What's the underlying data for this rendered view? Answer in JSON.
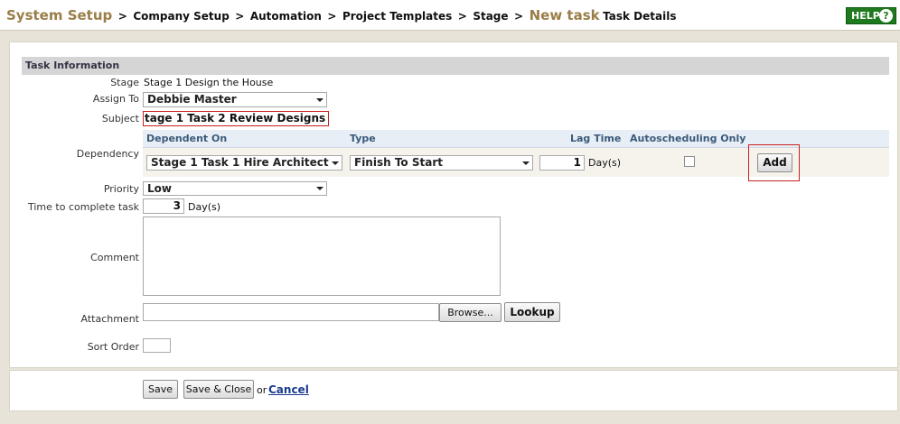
{
  "breadcrumb": {
    "root": "System Setup",
    "sep": ">",
    "items": [
      "Company Setup",
      "Automation",
      "Project Templates",
      "Stage"
    ],
    "current": "New task",
    "suffix": "Task Details"
  },
  "help": {
    "label": "HELP",
    "icon": "?"
  },
  "section": {
    "title": "Task Information"
  },
  "form": {
    "stage": {
      "label": "Stage",
      "value": "Stage 1 Design the House"
    },
    "assign_to": {
      "label": "Assign To",
      "value": "Debbie Master"
    },
    "subject": {
      "label": "Subject",
      "value": "tage 1 Task 2 Review Designs"
    },
    "dependency": {
      "label": "Dependency",
      "headers": {
        "dependent_on": "Dependent On",
        "type": "Type",
        "lag_time": "Lag Time",
        "autoscheduling": "Autoscheduling Only"
      },
      "row": {
        "dependent_on": "Stage 1 Task 1 Hire Architect",
        "type": "Finish To Start",
        "lag_value": "1",
        "lag_unit": "Day(s)",
        "autoscheduling_checked": false
      },
      "add_label": "Add"
    },
    "priority": {
      "label": "Priority",
      "value": "Low"
    },
    "time_to_complete": {
      "label": "Time to complete task",
      "value": "3",
      "unit": "Day(s)"
    },
    "comment": {
      "label": "Comment",
      "value": ""
    },
    "attachment": {
      "label": "Attachment",
      "value": "",
      "browse_label": "Browse...",
      "lookup_label": "Lookup"
    },
    "sort_order": {
      "label": "Sort Order",
      "value": ""
    }
  },
  "footer": {
    "save_label": "Save",
    "save_close_label": "Save & Close",
    "or_text": "or",
    "cancel_label": "Cancel"
  },
  "colors": {
    "accent_brown": "#9a7e48",
    "help_green": "#1f7a1f",
    "error_red": "#c81f1f",
    "link_blue": "#1b3b8f"
  }
}
